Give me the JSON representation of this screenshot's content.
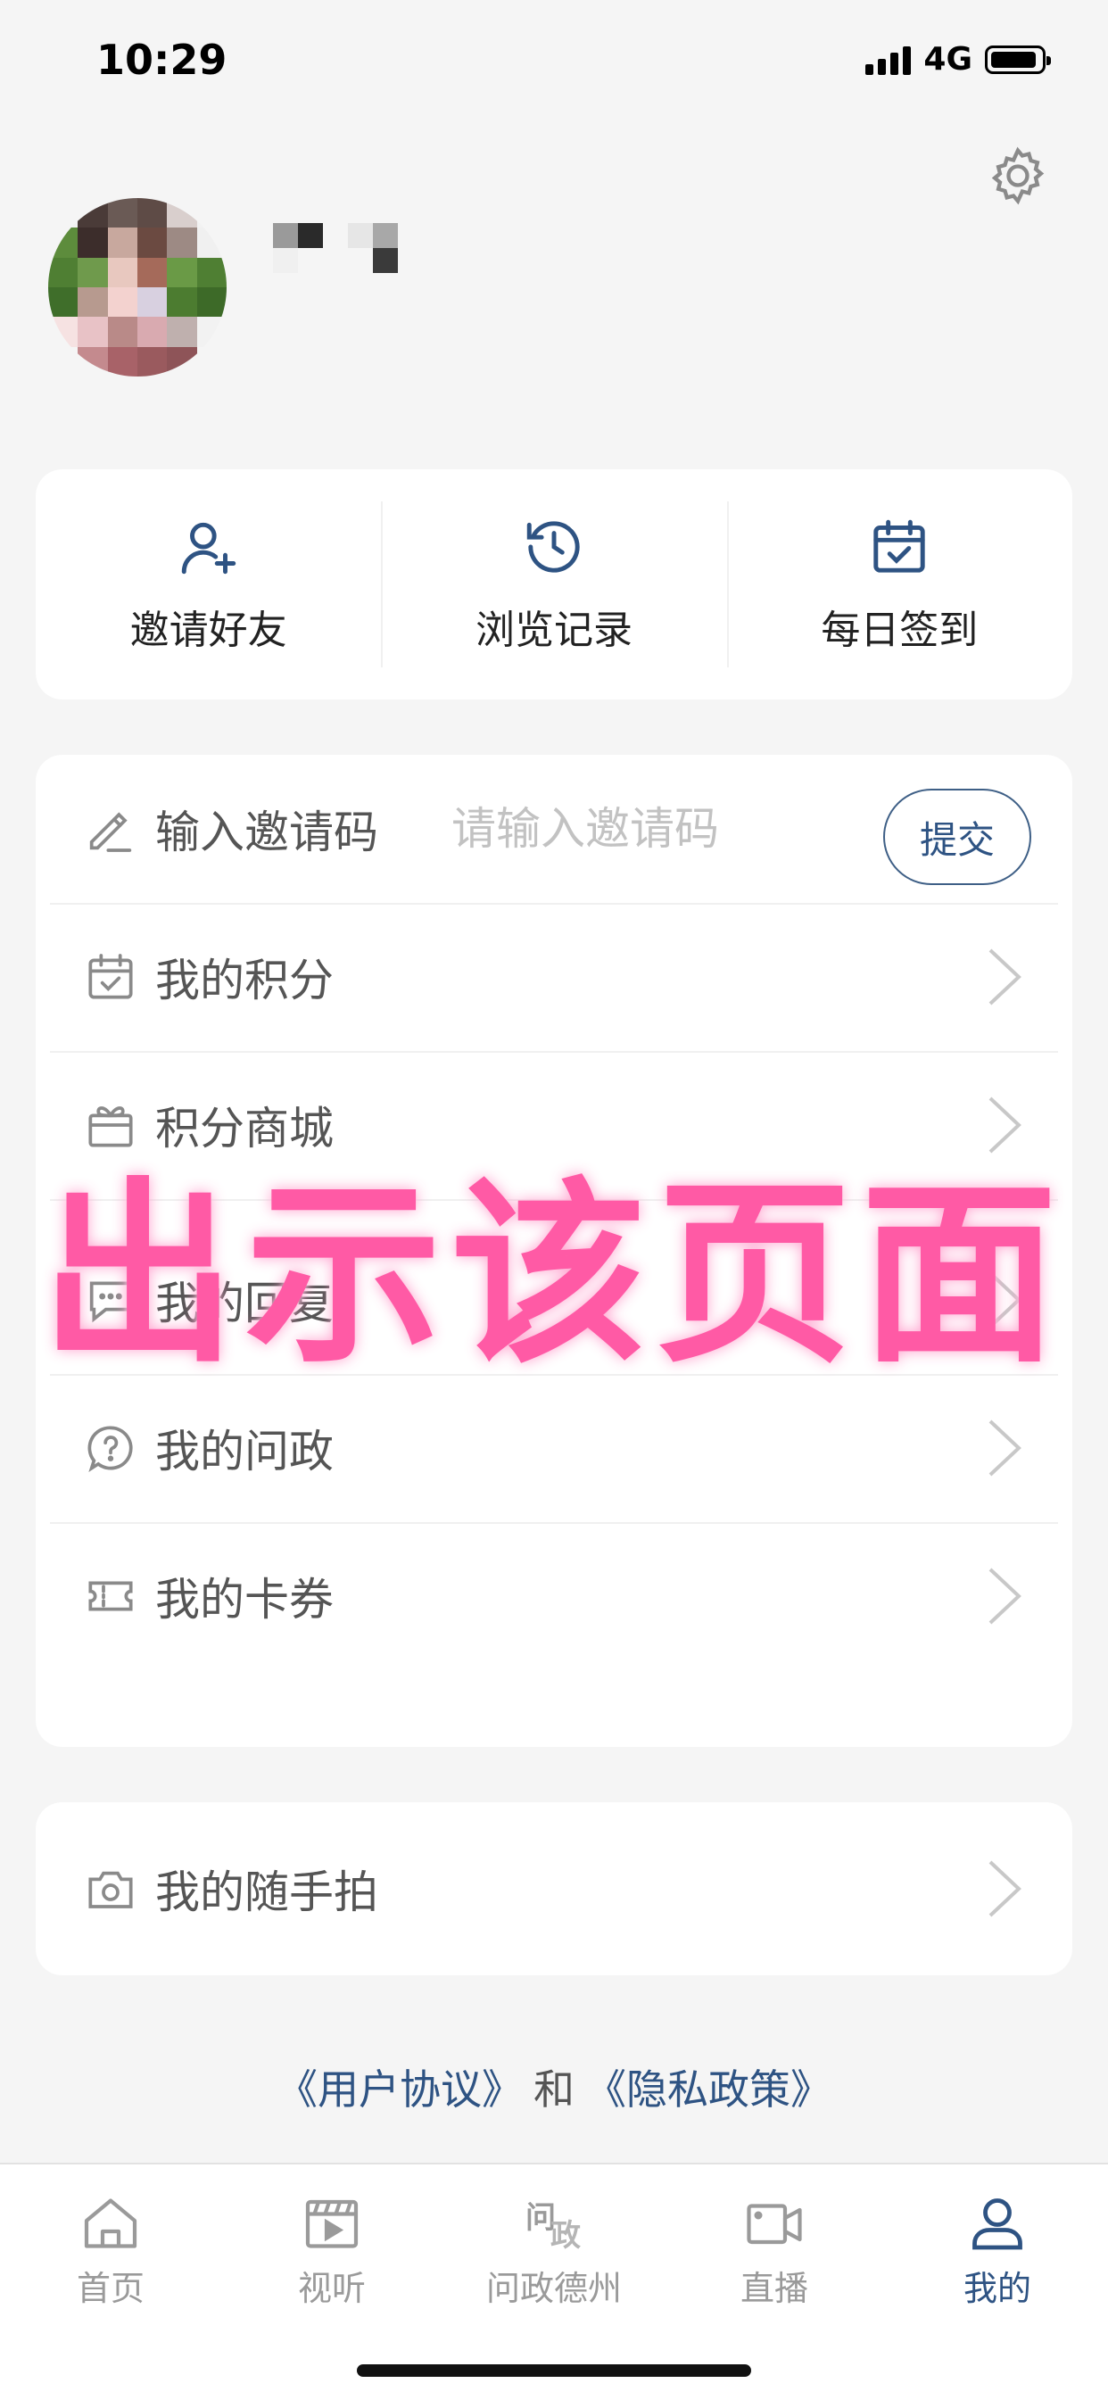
{
  "status_bar": {
    "time": "10:29",
    "network": "4G"
  },
  "quick_actions": [
    {
      "label": "邀请好友",
      "icon": "add-user-icon"
    },
    {
      "label": "浏览记录",
      "icon": "history-icon"
    },
    {
      "label": "每日签到",
      "icon": "calendar-check-icon"
    }
  ],
  "invite": {
    "label": "输入邀请码",
    "placeholder": "请输入邀请码",
    "submit_label": "提交"
  },
  "menu": [
    {
      "label": "我的积分",
      "icon": "calendar-check-icon"
    },
    {
      "label": "积分商城",
      "icon": "gift-icon"
    },
    {
      "label": "我的回复",
      "icon": "chat-bubble-icon"
    },
    {
      "label": "我的问政",
      "icon": "question-bubble-icon"
    },
    {
      "label": "我的卡券",
      "icon": "coupon-icon"
    }
  ],
  "menu2": [
    {
      "label": "我的随手拍",
      "icon": "camera-icon"
    }
  ],
  "footer": {
    "user_agreement": "《用户协议》",
    "and": "和",
    "privacy_policy": "《隐私政策》"
  },
  "overlay_text": "出示该页面",
  "tabs": [
    {
      "label": "首页",
      "icon": "home-icon",
      "active": false
    },
    {
      "label": "视听",
      "icon": "video-clapper-icon",
      "active": false
    },
    {
      "label": "问政德州",
      "icon": "wenzheng-icon",
      "active": false
    },
    {
      "label": "直播",
      "icon": "live-camera-icon",
      "active": false
    },
    {
      "label": "我的",
      "icon": "user-icon",
      "active": true
    }
  ],
  "colors": {
    "accent": "#2e5383",
    "overlay": "#ff5aa5",
    "background": "#f5f5f5"
  }
}
